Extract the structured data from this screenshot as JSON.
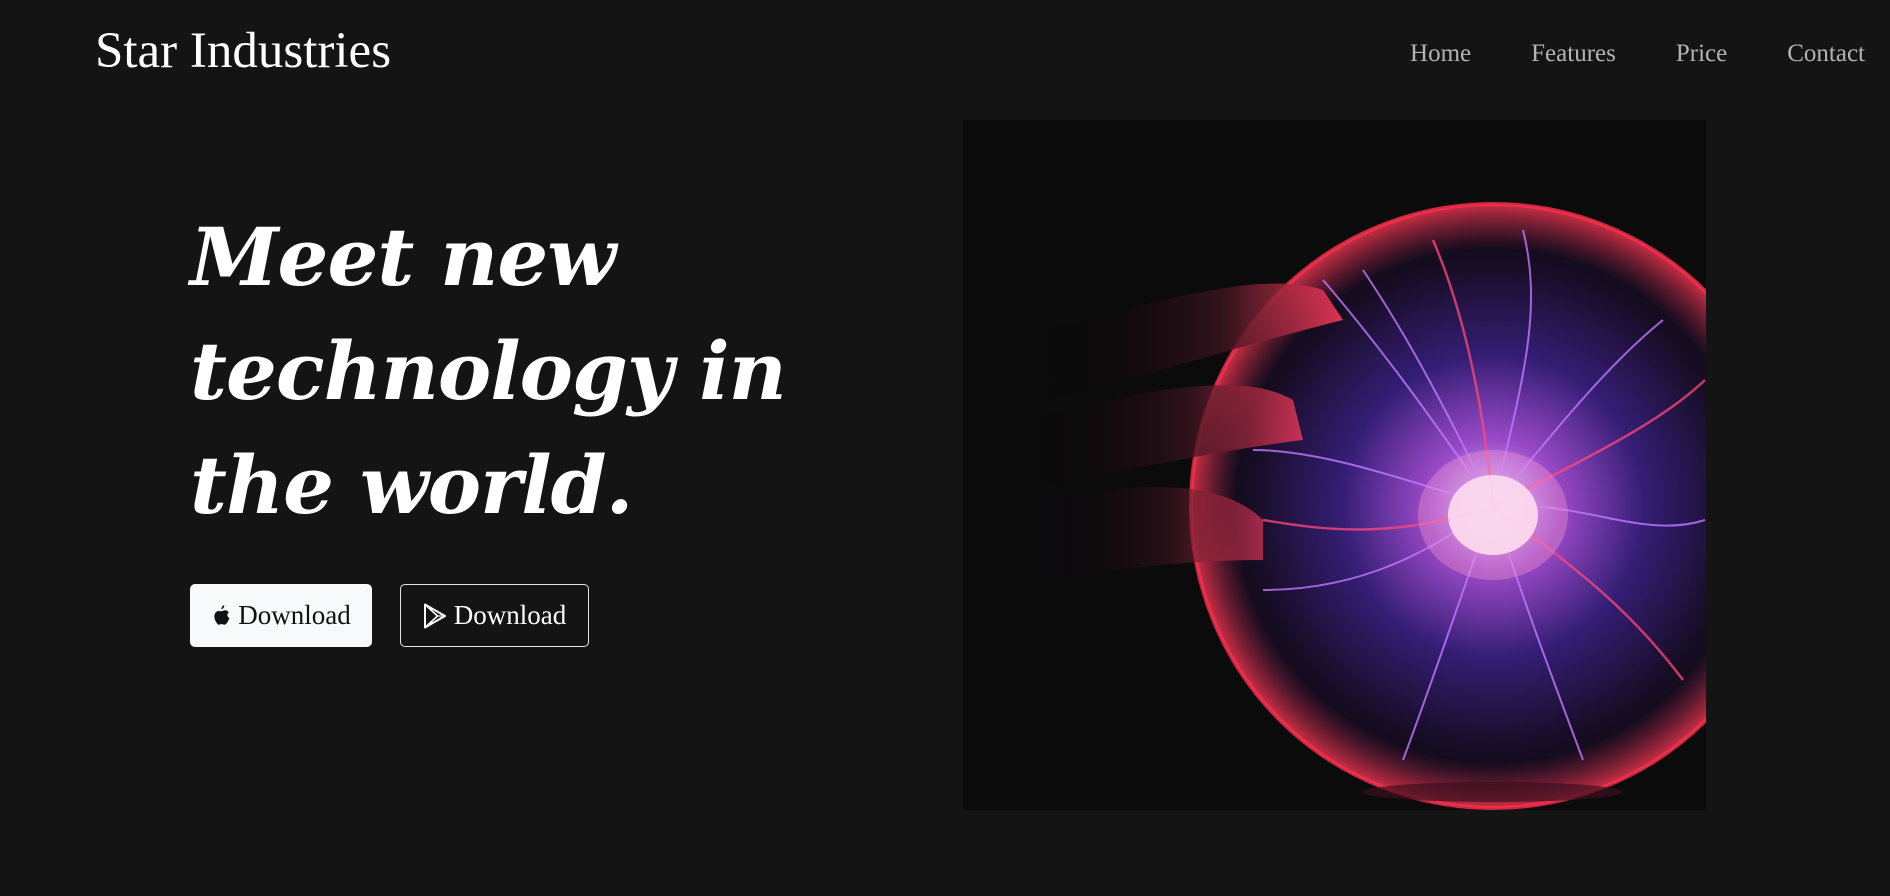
{
  "navbar": {
    "brand": "Star Industries",
    "links": [
      {
        "label": "Home"
      },
      {
        "label": "Features"
      },
      {
        "label": "Price"
      },
      {
        "label": "Contact"
      }
    ]
  },
  "hero": {
    "title": "Meet new technology in the world.",
    "buttons": {
      "apple": {
        "label": "Download",
        "icon": "apple-icon"
      },
      "play": {
        "label": "Download",
        "icon": "google-play-icon"
      }
    },
    "image": {
      "subject": "plasma-ball-with-hand"
    }
  },
  "colors": {
    "background": "#141414",
    "text": "#ffffff",
    "nav_link": "#b3b3b3",
    "light_button": "#f8f9fa"
  }
}
